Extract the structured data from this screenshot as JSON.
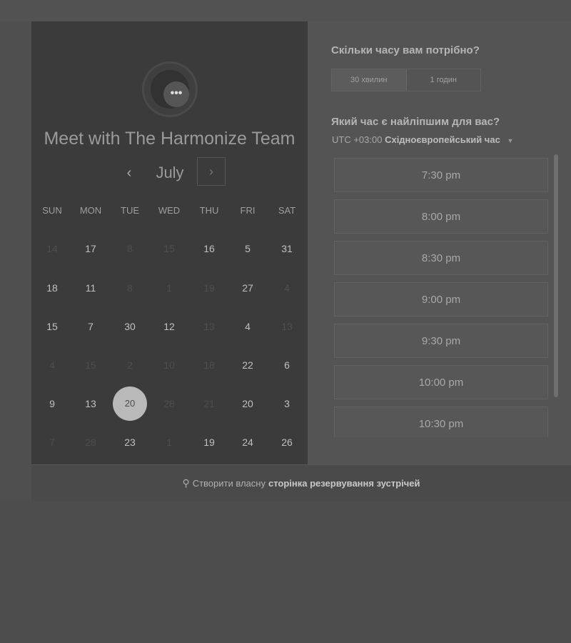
{
  "calendar": {
    "title": "Meet with The Harmonize Team",
    "month": "July",
    "prev_icon": "‹",
    "next_icon": "›",
    "avatar_symbol": "•••",
    "weekdays": [
      "SUN",
      "MON",
      "TUE",
      "WED",
      "THU",
      "FRI",
      "SAT"
    ],
    "rows": [
      [
        "14",
        "17",
        "8",
        "15",
        "16",
        "5",
        "31"
      ],
      [
        "18",
        "11",
        "8",
        "1",
        "19",
        "27",
        "4"
      ],
      [
        "15",
        "7",
        "30",
        "12",
        "13",
        "4",
        "13"
      ],
      [
        "4",
        "15",
        "2",
        "10",
        "18",
        "22",
        "6"
      ],
      [
        "9",
        "13",
        "20",
        "28",
        "21",
        "20",
        "3"
      ],
      [
        "7",
        "28",
        "23",
        "1",
        "19",
        "24",
        "26"
      ]
    ],
    "selected_day": "20"
  },
  "booking": {
    "duration_question": "Скільки часу вам потрібно?",
    "durations": [
      "30 хвилин",
      "1 годин"
    ],
    "time_question": "Який час є найліпшим для вас?",
    "timezone_offset": "UTC +03:00",
    "timezone_name": "Східноєвропейський час",
    "slots": [
      "7:30 pm",
      "8:00 pm",
      "8:30 pm",
      "9:00 pm",
      "9:30 pm",
      "10:00 pm",
      "10:30 pm"
    ]
  },
  "footer": {
    "prefix": "Створити власну",
    "link": "сторінка резервування зустрічей",
    "icon": "⚲"
  }
}
